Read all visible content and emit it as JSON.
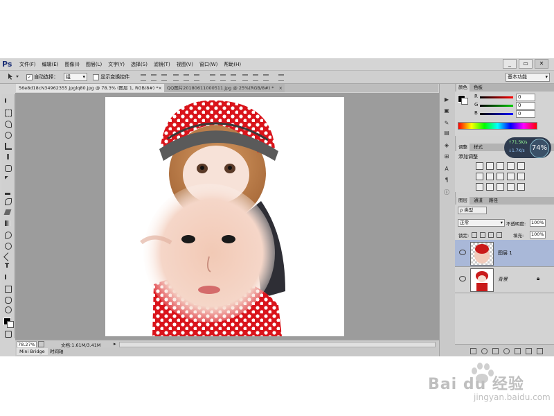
{
  "app": {
    "logo": "Ps",
    "menu": [
      "文件(F)",
      "编辑(E)",
      "图像(I)",
      "图层(L)",
      "文字(Y)",
      "选择(S)",
      "滤镜(T)",
      "视图(V)",
      "窗口(W)",
      "帮助(H)"
    ],
    "window_buttons": [
      "_",
      "▭",
      "✕"
    ]
  },
  "options": {
    "auto_select_label": "自动选择：",
    "auto_select_value": "组",
    "transform_label": "显示变换控件",
    "workspace": "基本功能"
  },
  "tabs": [
    {
      "label": "56e8d18cN34962355.jpglq80.jpg @ 78.3% (图层 1, RGB/8#) *",
      "close": "×"
    },
    {
      "label": "QQ图片20180611000511.jpg @ 25%(RGB/8#) *",
      "close": "×"
    }
  ],
  "status": {
    "zoom": "78.27%",
    "doc_label": "文档:1.61M/3.41M"
  },
  "bottom_tabs": [
    "Mini Bridge",
    "时间轴"
  ],
  "color_panel": {
    "tabs": [
      "颜色",
      "色板"
    ],
    "channels": [
      {
        "label": "R",
        "value": "0",
        "color": "#d01010"
      },
      {
        "label": "G",
        "value": "0",
        "color": "#10a010"
      },
      {
        "label": "B",
        "value": "0",
        "color": "#1010c0"
      }
    ]
  },
  "adjust_panel": {
    "tabs": [
      "调整",
      "样式"
    ],
    "title": "添加调整"
  },
  "layers_panel": {
    "tabs": [
      "图层",
      "通道",
      "路径"
    ],
    "filter_label": "ρ 类型",
    "blend_mode": "正常",
    "opacity_label": "不透明度:",
    "opacity_value": "100%",
    "lock_label": "锁定:",
    "fill_label": "填充:",
    "fill_value": "100%",
    "layers": [
      {
        "name": "图层 1",
        "selected": true
      },
      {
        "name": "背景",
        "selected": false
      }
    ]
  },
  "speed_widget": {
    "percent": "74%",
    "up": "↑71.5K/s",
    "down": "↓1.7K/s"
  },
  "watermark": {
    "brand": "Bai du 经验",
    "url": "jingyan.baidu.com"
  },
  "colors": {
    "accent_selected_layer": "#a9b8d8",
    "canvas_bg": "#9c9c9c",
    "panel_bg": "#d3d3d3"
  }
}
